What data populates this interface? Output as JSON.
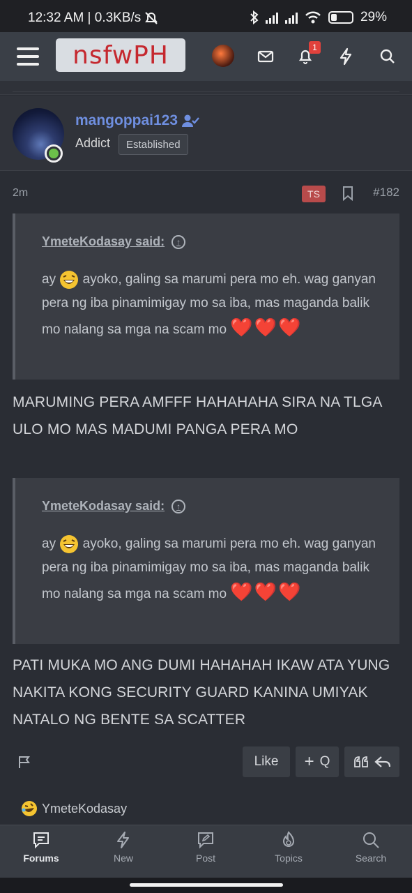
{
  "status_bar": {
    "time_speed": "12:32 AM | 0.3KB/s",
    "battery": "29%"
  },
  "header": {
    "logo": "nsfwPH",
    "notification_count": "1",
    "icons": [
      "menu-icon",
      "avatar",
      "mail-icon",
      "bell-icon",
      "bolt-icon",
      "search-icon"
    ]
  },
  "post": {
    "username": "mangoppai123",
    "user_title": "Addict",
    "user_banner": "Established",
    "time": "2m",
    "ts_badge": "TS",
    "post_number": "#182",
    "quotes": [
      {
        "author": "YmeteKodasay said:",
        "text_before_emoji": "ay",
        "text_after_emoji": "ayoko, galing sa marumi pera mo eh. wag ganyan pera ng iba pinamimigay mo sa iba, mas maganda balik mo nalang sa mga na scam mo",
        "hearts": "❤️❤️❤️"
      },
      {
        "author": "YmeteKodasay said:",
        "text_before_emoji": "ay",
        "text_after_emoji": "ayoko, galing sa marumi pera mo eh. wag ganyan pera ng iba pinamimigay mo sa iba, mas maganda balik mo nalang sa mga na scam mo",
        "hearts": "❤️❤️❤️"
      }
    ],
    "replies": [
      "MARUMING PERA AMFFF HAHAHAHA SIRA NA TLGA ULO MO MAS MADUMI PANGA PERA MO",
      "PATI MUKA MO ANG DUMI HAHAHAH IKAW ATA YUNG NAKITA KONG SECURITY GUARD KANINA UMIYAK NATALO NG BENTE SA SCATTER"
    ],
    "actions": {
      "like": "Like",
      "quote_plus": "+",
      "quote_q": "Q"
    },
    "reaction_user": "YmeteKodasay"
  },
  "bottom_nav": [
    {
      "label": "Forums",
      "icon": "forums-icon",
      "active": true
    },
    {
      "label": "New",
      "icon": "bolt-icon",
      "active": false
    },
    {
      "label": "Post",
      "icon": "post-icon",
      "active": false
    },
    {
      "label": "Topics",
      "icon": "topics-icon",
      "active": false
    },
    {
      "label": "Search",
      "icon": "search-icon",
      "active": false
    }
  ],
  "colors": {
    "background": "#2a2d34",
    "header": "#3a3f47",
    "username": "#6f8fe0",
    "ts_badge": "#b84b4b",
    "heart": "#e0201e"
  }
}
